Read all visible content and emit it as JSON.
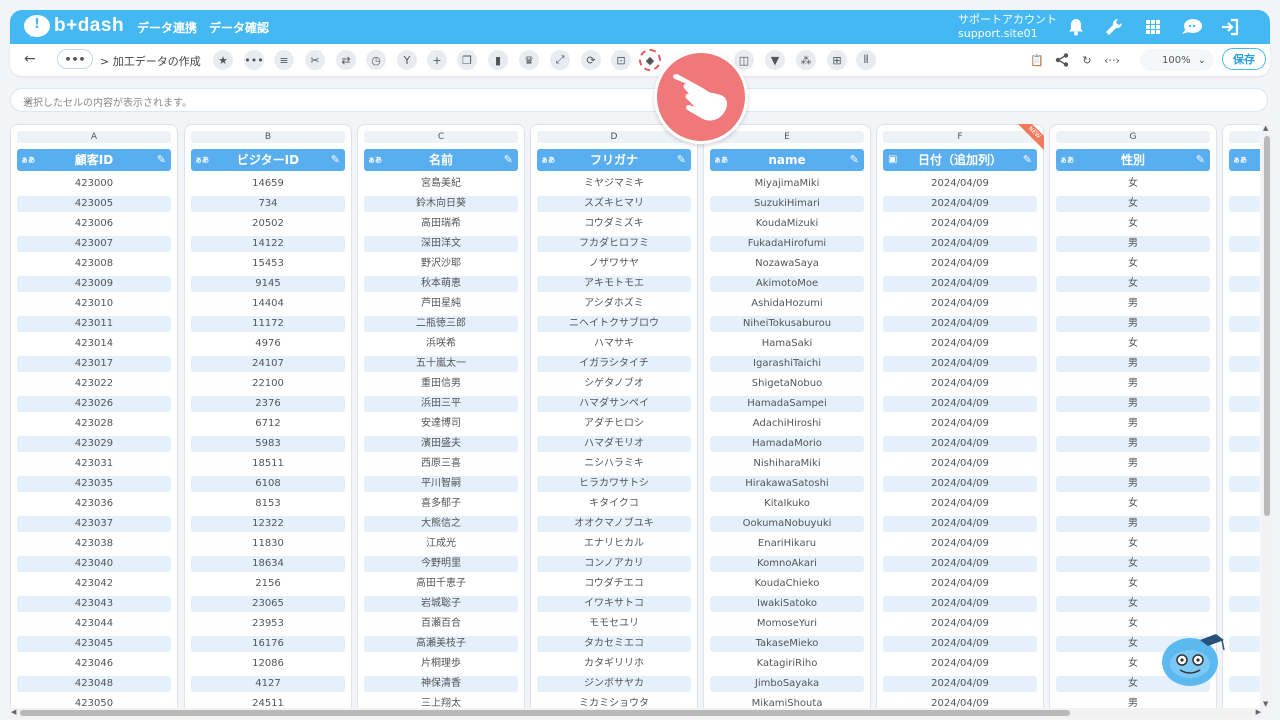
{
  "app": {
    "logo_text": "b+dash",
    "logo_mark": "!"
  },
  "header": {
    "nav": [
      "データ連携",
      "データ確認"
    ],
    "account_name": "サポートアカウント",
    "account_site": "support.site01"
  },
  "toolbar": {
    "breadcrumb": "> 加工データの作成",
    "dots": "•••",
    "zoom": "100%",
    "save_label": "保存"
  },
  "cellbar": {
    "placeholder": "選択したセルの内容が表示されます。"
  },
  "type_label": "ぁあ",
  "new_badge": "NEW",
  "columns": [
    {
      "letter": "A",
      "title": "顧客ID",
      "values": [
        "423000",
        "423005",
        "423006",
        "423007",
        "423008",
        "423009",
        "423010",
        "423011",
        "423014",
        "423017",
        "423022",
        "423026",
        "423028",
        "423029",
        "423031",
        "423035",
        "423036",
        "423037",
        "423038",
        "423040",
        "423042",
        "423043",
        "423044",
        "423045",
        "423046",
        "423048",
        "423050"
      ]
    },
    {
      "letter": "B",
      "title": "ビジターID",
      "values": [
        "14659",
        "734",
        "20502",
        "14122",
        "15453",
        "9145",
        "14404",
        "11172",
        "4976",
        "24107",
        "22100",
        "2376",
        "6712",
        "5983",
        "18511",
        "6108",
        "8153",
        "12322",
        "11830",
        "18634",
        "2156",
        "23065",
        "23953",
        "16176",
        "12086",
        "4127",
        "24511"
      ]
    },
    {
      "letter": "C",
      "title": "名前",
      "values": [
        "宮島美紀",
        "鈴木向日葵",
        "高田瑞希",
        "深田洋文",
        "野沢沙耶",
        "秋本萌恵",
        "芦田星純",
        "二瓶徳三郎",
        "浜咲希",
        "五十嵐太一",
        "重田信男",
        "浜田三平",
        "安達博司",
        "濱田盛夫",
        "西原三喜",
        "平川智嗣",
        "喜多郁子",
        "大熊信之",
        "江成光",
        "今野明里",
        "高田千恵子",
        "岩城聡子",
        "百瀬百合",
        "高瀬美枝子",
        "片桐理歩",
        "神保清香",
        "三上翔太"
      ]
    },
    {
      "letter": "D",
      "title": "フリガナ",
      "values": [
        "ミヤジマミキ",
        "スズキヒマリ",
        "コウダミズキ",
        "フカダヒロフミ",
        "ノザワサヤ",
        "アキモトモエ",
        "アシダホズミ",
        "ニヘイトクサブロウ",
        "ハマサキ",
        "イガラシタイチ",
        "シゲタノブオ",
        "ハマダサンペイ",
        "アダチヒロシ",
        "ハマダモリオ",
        "ニシハラミキ",
        "ヒラカワサトシ",
        "キタイクコ",
        "オオクマノブユキ",
        "エナリヒカル",
        "コンノアカリ",
        "コウダチエコ",
        "イワキサトコ",
        "モモセユリ",
        "タカセミエコ",
        "カタギリリホ",
        "ジンボサヤカ",
        "ミカミショウタ"
      ]
    },
    {
      "letter": "E",
      "title": "name",
      "values": [
        "MiyajimaMiki",
        "SuzukiHimari",
        "KoudaMizuki",
        "FukadaHirofumi",
        "NozawaSaya",
        "AkimotoMoe",
        "AshidaHozumi",
        "NiheiTokusaburou",
        "HamaSaki",
        "IgarashiTaichi",
        "ShigetaNobuo",
        "HamadaSampei",
        "AdachiHiroshi",
        "HamadaMorio",
        "NishiharaMiki",
        "HirakawaSatoshi",
        "KitaIkuko",
        "OokumaNobuyuki",
        "EnariHikaru",
        "KomnoAkari",
        "KoudaChieko",
        "IwakiSatoko",
        "MomoseYuri",
        "TakaseMieko",
        "KatagiriRiho",
        "JimboSayaka",
        "MikamiShouta"
      ]
    },
    {
      "letter": "F",
      "title": "日付（追加列）",
      "values": [
        "2024/04/09",
        "2024/04/09",
        "2024/04/09",
        "2024/04/09",
        "2024/04/09",
        "2024/04/09",
        "2024/04/09",
        "2024/04/09",
        "2024/04/09",
        "2024/04/09",
        "2024/04/09",
        "2024/04/09",
        "2024/04/09",
        "2024/04/09",
        "2024/04/09",
        "2024/04/09",
        "2024/04/09",
        "2024/04/09",
        "2024/04/09",
        "2024/04/09",
        "2024/04/09",
        "2024/04/09",
        "2024/04/09",
        "2024/04/09",
        "2024/04/09",
        "2024/04/09",
        "2024/04/09"
      ]
    },
    {
      "letter": "G",
      "title": "性別",
      "values": [
        "女",
        "女",
        "女",
        "男",
        "女",
        "女",
        "男",
        "男",
        "女",
        "男",
        "男",
        "男",
        "男",
        "男",
        "男",
        "男",
        "女",
        "男",
        "女",
        "女",
        "女",
        "女",
        "女",
        "女",
        "女",
        "女",
        "男"
      ]
    }
  ],
  "icons": {
    "header": [
      "bell-icon",
      "wrench-icon",
      "grid-icon",
      "chat-icon",
      "logout-icon"
    ],
    "toolbar": [
      "star-icon",
      "more-icon",
      "list-icon",
      "tools-icon",
      "swap-icon",
      "timer-icon",
      "branch-icon",
      "plus-icon",
      "copy-icon",
      "trash-icon",
      "crown-icon",
      "expand-icon",
      "refresh-icon",
      "lock-icon",
      "bag-icon"
    ],
    "toolbar_right": [
      "frame-icon",
      "filter-icon",
      "spray-icon",
      "table-icon",
      "split-icon"
    ],
    "actions": [
      "clipboard-icon",
      "share-icon",
      "history-icon",
      "code-icon"
    ]
  },
  "colors": {
    "header": "#44b8f3",
    "column_header": "#59aef0",
    "row_alt": "#e4f0fb",
    "pointer": "#f07878"
  }
}
